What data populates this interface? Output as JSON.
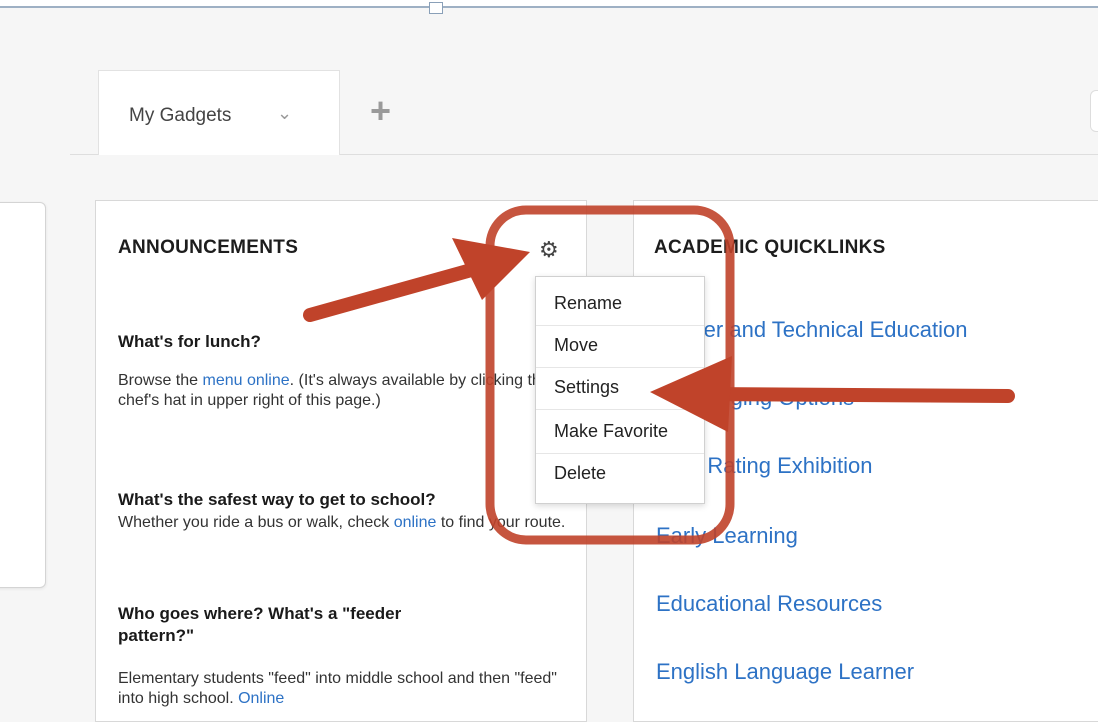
{
  "tabs": {
    "active_label": "My Gadgets",
    "chevron_icon": "chevron-down-icon",
    "add_icon": "plus-icon",
    "add_glyph": "+",
    "chevron_glyph": "⌄"
  },
  "announcements": {
    "title": "ANNOUNCEMENTS",
    "settings_icon": "gear-icon",
    "gear_glyph": "⚙",
    "items": [
      {
        "question": "What's for lunch?",
        "text_before": "Browse the ",
        "link": "menu online",
        "text_after": ". (It's always available by clicking the chef's hat in upper right of this page.)"
      },
      {
        "question": "What's the safest way to get to school?",
        "text_before": "Whether you ride a bus or walk, check ",
        "link": "online",
        "text_after": " to find your route."
      },
      {
        "question": "Who goes where? What's a \"feeder pattern?\"",
        "text_before": "Elementary students \"feed\" into middle school and then \"feed\" into high school. ",
        "link": "Online",
        "text_after": ""
      }
    ]
  },
  "context_menu": {
    "items": [
      "Rename",
      "Move",
      "Settings",
      "Make Favorite",
      "Delete"
    ]
  },
  "quicklinks": {
    "title": "ACADEMIC QUICKLINKS",
    "links": [
      "Career and Technical Education",
      "Challenging Options",
      "Dual Rating Exhibition",
      "Early Learning",
      "Educational Resources",
      "English Language Learner"
    ]
  },
  "colors": {
    "link": "#2d72c5",
    "annotation": "#c0432a"
  }
}
